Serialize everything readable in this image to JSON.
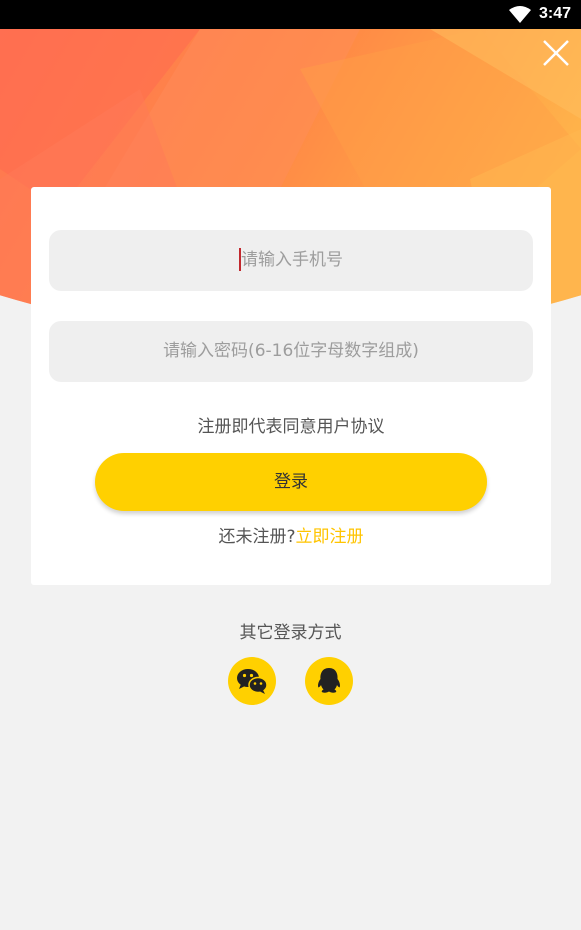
{
  "status_bar": {
    "time": "3:47"
  },
  "form": {
    "phone_placeholder": "请输入手机号",
    "password_placeholder": "请输入密码(6-16位字母数字组成)",
    "agreement_text": "注册即代表同意用户协议",
    "login_label": "登录",
    "register_prompt": "还未注册?",
    "register_link": "立即注册"
  },
  "other_login": {
    "title": "其它登录方式",
    "icons": [
      "wechat-icon",
      "qq-icon"
    ]
  },
  "colors": {
    "accent": "#ffd000",
    "link": "#ffc400",
    "banner_start": "#ff7a50",
    "banner_end": "#ffb040"
  }
}
